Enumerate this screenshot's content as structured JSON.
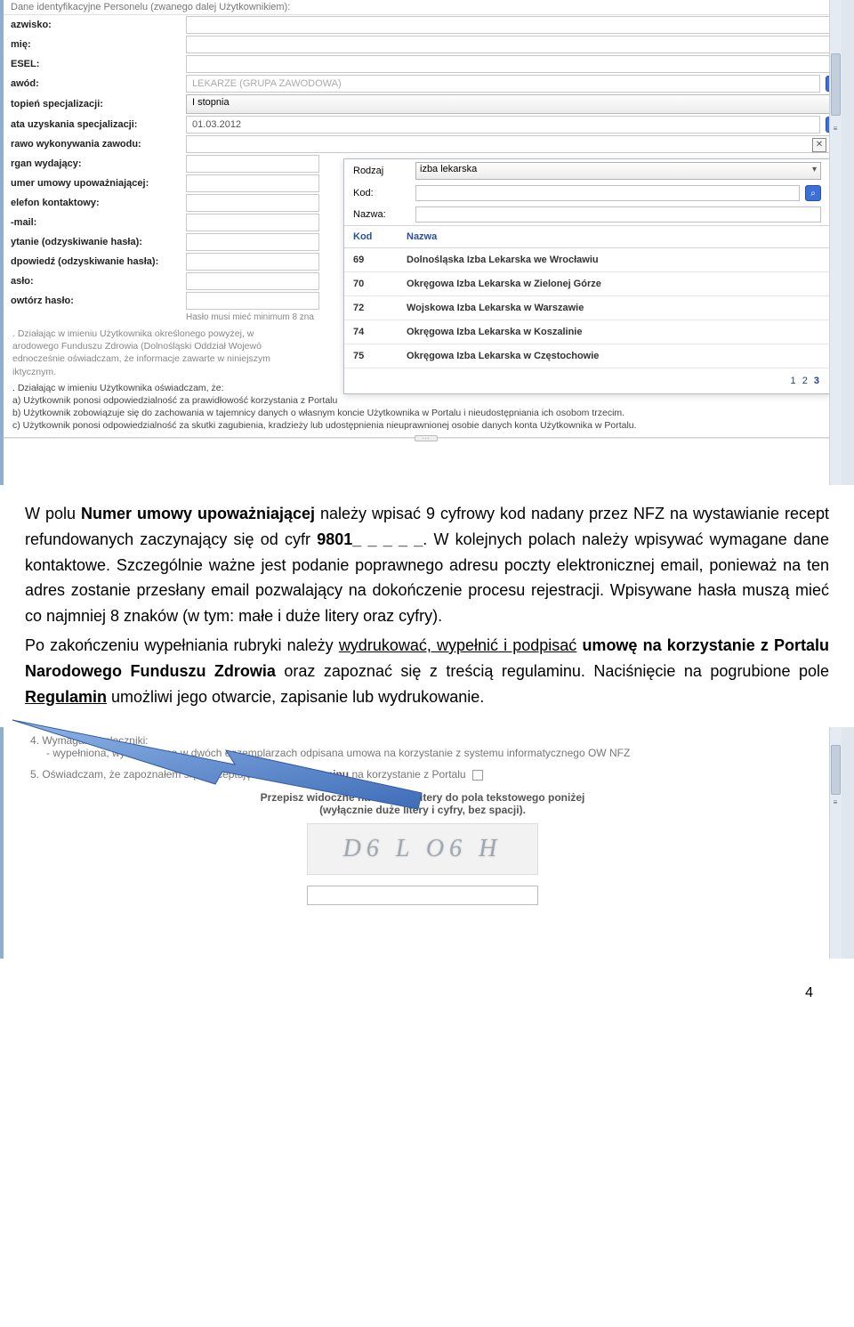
{
  "top_title": "Dane identyfikacyjne Personelu (zwanego dalej Użytkownikiem):",
  "form": {
    "nazwisko": "azwisko:",
    "imie": "mię:",
    "pesel": "ESEL:",
    "zawod": "awód:",
    "zawod_val": "LEKARZE (GRUPA ZAWODOWA)",
    "stopien": "topień specjalizacji:",
    "stopien_val": "I stopnia",
    "data_spec": "ata uzyskania specjalizacji:",
    "data_spec_val": "01.03.2012",
    "prawo": "rawo wykonywania zawodu:",
    "organ": "rgan wydający:",
    "umowa": "umer umowy upoważniającej:",
    "telefon": "elefon kontaktowy:",
    "email": "-mail:",
    "pytanie": "ytanie (odzyskiwanie hasła):",
    "odpowiedz": "dpowiedź (odzyskiwanie hasła):",
    "haslo": "asło:",
    "powtorz": "owtórz hasło:",
    "hint": "Hasło musi mieć minimum 8 zna"
  },
  "popup": {
    "rodzaj_lbl": "Rodzaj",
    "rodzaj_val": "izba lekarska",
    "kod_lbl": "Kod:",
    "nazwa_lbl": "Nazwa:",
    "head_kod": "Kod",
    "head_nazwa": "Nazwa",
    "rows": [
      {
        "kod": "69",
        "nazwa": "Dolnośląska Izba Lekarska we Wrocławiu"
      },
      {
        "kod": "70",
        "nazwa": "Okręgowa Izba Lekarska w Zielonej Górze"
      },
      {
        "kod": "72",
        "nazwa": "Wojskowa Izba Lekarska w Warszawie"
      },
      {
        "kod": "74",
        "nazwa": "Okręgowa Izba Lekarska w Koszalinie"
      },
      {
        "kod": "75",
        "nazwa": "Okręgowa Izba Lekarska w Częstochowie"
      }
    ],
    "pager": [
      "1",
      "2",
      "3"
    ]
  },
  "legal1a": ". Działając w imieniu Użytkownika określonego powyżej, w",
  "legal1b": "arodowego Funduszu Zdrowia (Dolnośląski Oddział Wojewó",
  "legal1c": "ednocześnie oświadczam, że informacje zawarte w niniejszym",
  "legal1d": "iktycznym.",
  "legal2a": ". Działając w imieniu Użytkownika oświadczam, że:",
  "legal2b": "a) Użytkownik ponosi odpowiedzialność za prawidłowość korzystania z Portalu",
  "legal2c": "b) Użytkownik zobowiązuje się do zachowania w tajemnicy danych o własnym koncie Użytkownika w Portalu i nieudostępniania ich osobom trzecim.",
  "legal2d": "c) Użytkownik ponosi odpowiedzialność za skutki zagubienia, kradzieży lub udostępnienia nieuprawnionej osobie danych konta Użytkownika w Portalu.",
  "article": {
    "p1_a": "W polu ",
    "p1_b": "Numer umowy upoważniającej",
    "p1_c": " należy wpisać 9 cyfrowy kod nadany przez NFZ na wystawianie recept refundowanych zaczynający się od cyfr ",
    "p1_d": "9801_ _ _ _ _",
    "p1_e": ". W kolejnych polach należy wpisywać wymagane dane kontaktowe. Szczególnie ważne jest podanie poprawnego adresu poczty elektronicznej email, ponieważ  na ten adres zostanie przesłany email pozwalający na dokończenie procesu rejestracji. Wpisywane hasła muszą mieć co najmniej 8 znaków (w tym: małe i duże litery oraz cyfry).",
    "p2_a": "Po zakończeniu wypełniania rubryki należy ",
    "p2_b": "wydrukować, wypełnić i podpisać",
    "p2_c": " ",
    "p2_d": "umowę na korzystanie z Portalu Narodowego Funduszu Zdrowia",
    "p2_e": " oraz zapoznać się z treścią regulaminu. Naciśnięcie na pogrubione pole ",
    "p2_f": "Regulamin",
    "p2_g": " umożliwi jego otwarcie, zapisanie lub wydrukowanie."
  },
  "bottom": {
    "l1a": "4. Wymagane załączniki:",
    "l1b": "-  wypełniona,  wydrukowana  w  dwóch  egzemplarzach   odpisana  umowa  na  korzystanie  z  systemu informatycznego OW NFZ",
    "l2a": "5. Oświadczam, że zapoznałem się i akceptuję zapisy ",
    "l2b": "Regulaminu",
    "l2c": " na korzystanie z Portalu",
    "cap_t1": "Przepisz widoczne na obrazku litery do pola tekstowego poniżej",
    "cap_t2": "(wyłącznie duże litery i cyfry, bez spacji).",
    "cap_img": "D6 L O6 H"
  },
  "page_no": "4"
}
